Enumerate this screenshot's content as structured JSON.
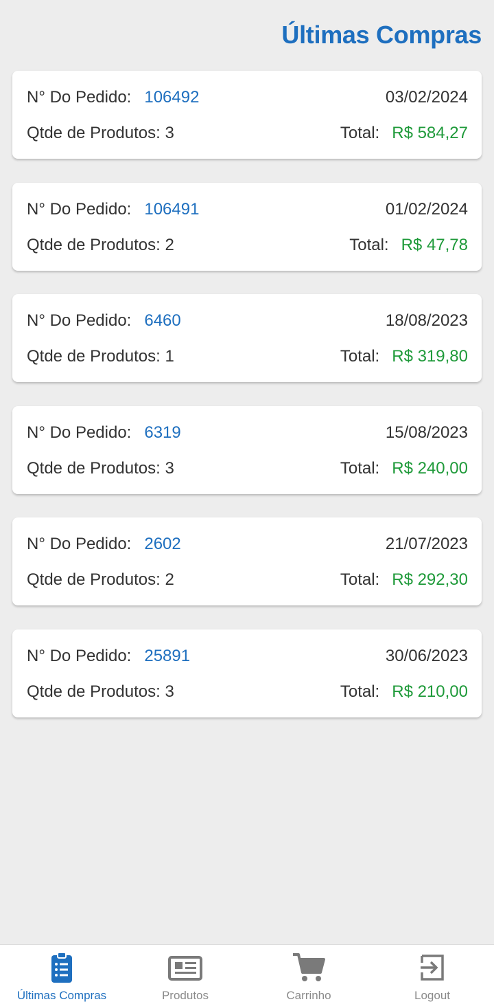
{
  "header": {
    "title": "Últimas Compras"
  },
  "labels": {
    "order_number": "N° Do Pedido:",
    "product_qty": "Qtde de Produtos:",
    "total": "Total:"
  },
  "orders": [
    {
      "id": "106492",
      "date": "03/02/2024",
      "qty": "3",
      "total": "R$ 584,27"
    },
    {
      "id": "106491",
      "date": "01/02/2024",
      "qty": "2",
      "total": "R$ 47,78"
    },
    {
      "id": "6460",
      "date": "18/08/2023",
      "qty": "1",
      "total": "R$ 319,80"
    },
    {
      "id": "6319",
      "date": "15/08/2023",
      "qty": "3",
      "total": "R$ 240,00"
    },
    {
      "id": "2602",
      "date": "21/07/2023",
      "qty": "2",
      "total": "R$ 292,30"
    },
    {
      "id": "25891",
      "date": "30/06/2023",
      "qty": "3",
      "total": "R$ 210,00"
    }
  ],
  "nav": {
    "items": [
      {
        "label": "Últimas Compras",
        "icon": "clipboard-list-icon",
        "active": true
      },
      {
        "label": "Produtos",
        "icon": "newspaper-icon",
        "active": false
      },
      {
        "label": "Carrinho",
        "icon": "shopping-cart-icon",
        "active": false
      },
      {
        "label": "Logout",
        "icon": "sign-out-icon",
        "active": false
      }
    ]
  },
  "colors": {
    "accent": "#1e6fbf",
    "total_green": "#1f9a3a",
    "background": "#ededed",
    "icon_gray": "#7a7a7a"
  }
}
